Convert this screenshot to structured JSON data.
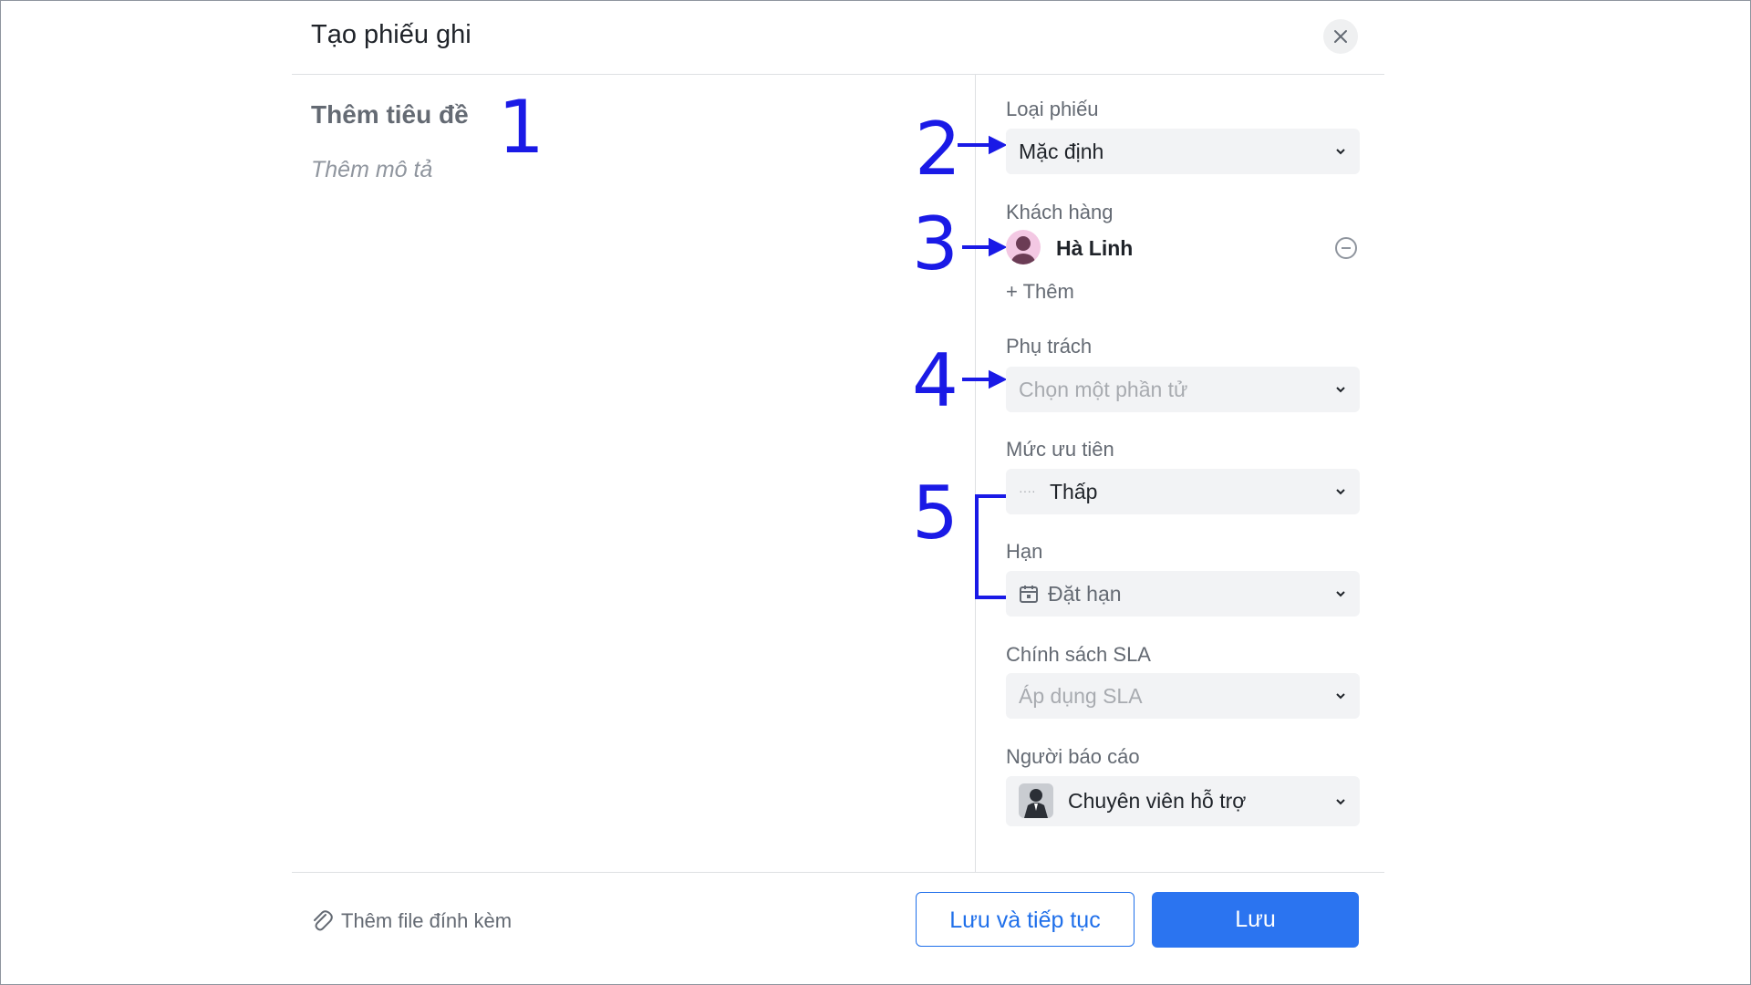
{
  "dialog": {
    "title": "Tạo phiếu ghi",
    "close_icon": "close-icon"
  },
  "left": {
    "title_placeholder": "Thêm tiêu đề",
    "description_placeholder": "Thêm mô tả"
  },
  "fields": {
    "ticket_type": {
      "label": "Loại phiếu",
      "value": "Mặc định"
    },
    "customer": {
      "label": "Khách hàng",
      "name": "Hà Linh",
      "add_label": "+ Thêm"
    },
    "assignee": {
      "label": "Phụ trách",
      "placeholder": "Chọn một phần tử"
    },
    "priority": {
      "label": "Mức ưu tiên",
      "value": "Thấp",
      "indicator": "····"
    },
    "deadline": {
      "label": "Hạn",
      "value": "Đặt hạn"
    },
    "sla": {
      "label": "Chính sách SLA",
      "placeholder": "Áp dụng SLA"
    },
    "reporter": {
      "label": "Người báo cáo",
      "value": "Chuyên viên hỗ trợ"
    }
  },
  "annotations": [
    "1",
    "2",
    "3",
    "4",
    "5"
  ],
  "footer": {
    "attach_label": "Thêm file đính kèm",
    "save_continue_label": "Lưu và tiếp tục",
    "save_label": "Lưu"
  },
  "colors": {
    "primary": "#2b74f0",
    "annotation": "#1a1ae6",
    "field_bg": "#f2f3f5"
  }
}
